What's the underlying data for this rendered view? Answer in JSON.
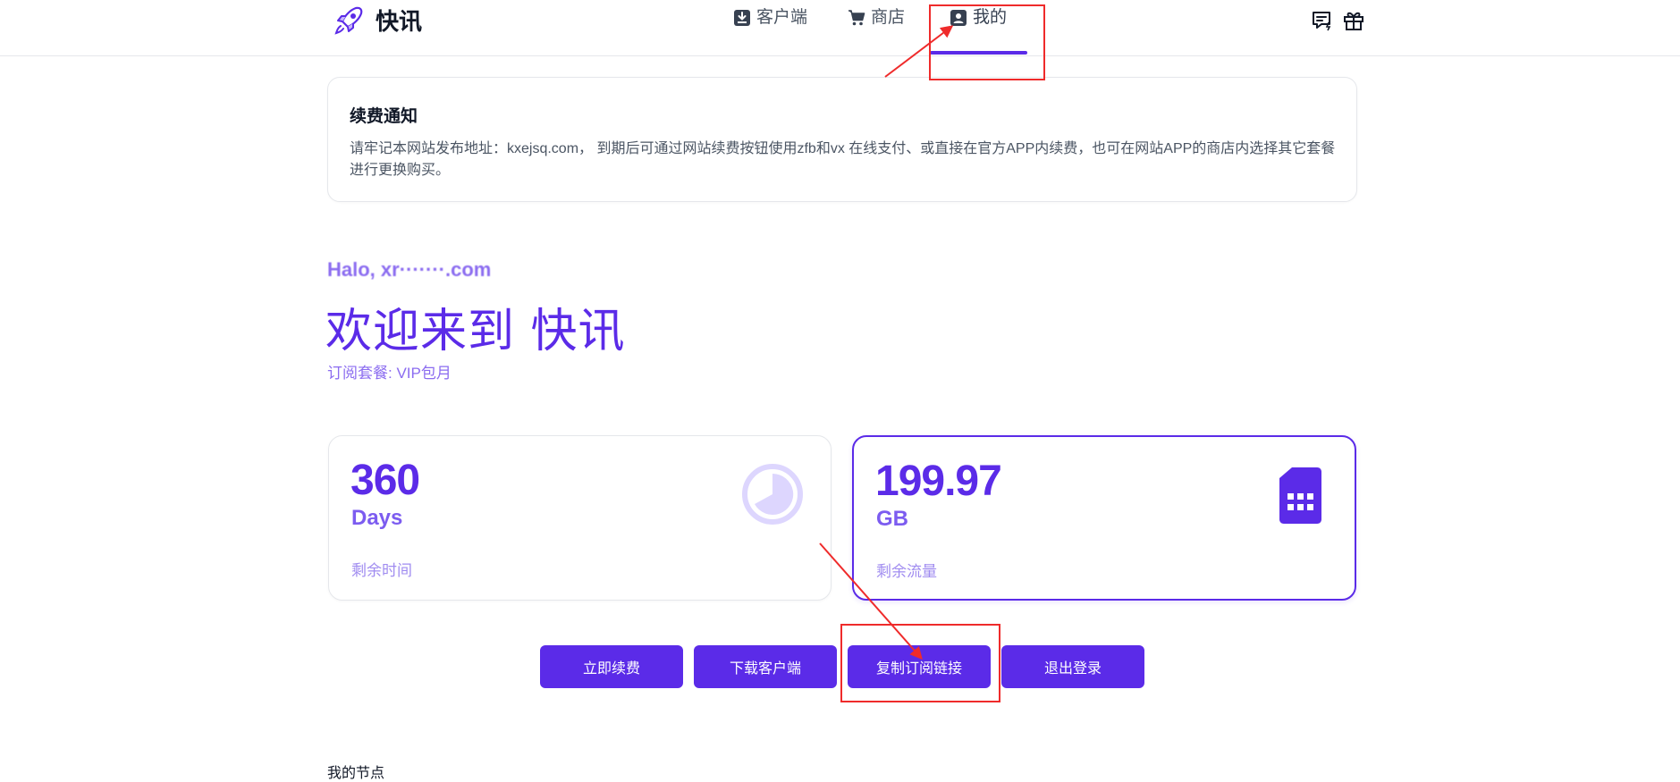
{
  "header": {
    "brand_name": "快讯",
    "nav": [
      {
        "label": "客户端",
        "icon": "download-icon"
      },
      {
        "label": "商店",
        "icon": "cart-icon"
      },
      {
        "label": "我的",
        "icon": "user-card-icon",
        "active": true
      }
    ],
    "right_icons": [
      "message-icon",
      "gift-icon"
    ]
  },
  "notice": {
    "title": "续费通知",
    "body": "请牢记本网站发布地址：kxejsq.com， 到期后可通过网站续费按钮使用zfb和vx 在线支付、或直接在官方APP内续费，也可在网站APP的商店内选择其它套餐进行更换购买。"
  },
  "welcome": {
    "hello": "Halo, xr·······.com",
    "title": "欢迎来到 快讯",
    "plan": "订阅套餐: VIP包月"
  },
  "stats": [
    {
      "value": "360",
      "unit": "Days",
      "caption": "剩余时间",
      "icon": "pie-timer-icon"
    },
    {
      "value": "199.97",
      "unit": "GB",
      "caption": "剩余流量",
      "icon": "sim-card-icon"
    }
  ],
  "actions": {
    "renew": "立即续费",
    "download": "下载客户端",
    "copy_link": "复制订阅链接",
    "logout": "退出登录"
  },
  "section": {
    "my_nodes": "我的节点"
  },
  "colors": {
    "accent": "#5b2be8",
    "annotation": "#ef2b2b"
  }
}
